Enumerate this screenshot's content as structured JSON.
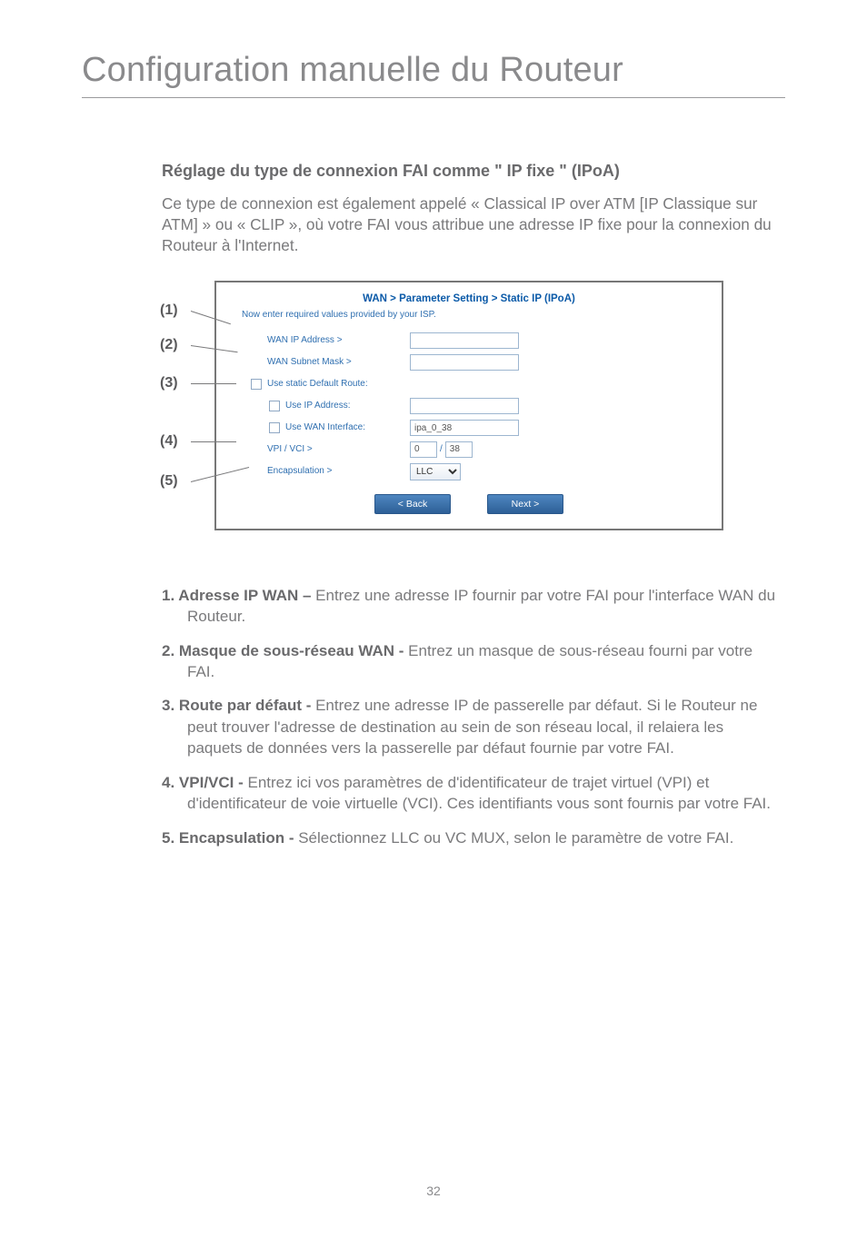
{
  "page": {
    "title": "Configuration manuelle du Routeur",
    "section_heading": "Réglage du type de connexion FAI comme \" IP fixe \" (IPoA)",
    "intro": "Ce type de connexion est également appelé « Classical IP over ATM [IP Classique sur ATM] » ou « CLIP », où votre FAI vous attribue une adresse IP fixe pour la connexion du Routeur à l'Internet.",
    "page_number": "32"
  },
  "callouts": {
    "c1": "(1)",
    "c2": "(2)",
    "c3": "(3)",
    "c4": "(4)",
    "c5": "(5)"
  },
  "shot": {
    "title": "WAN > Parameter Setting > Static IP (IPoA)",
    "subtitle": "Now enter required values provided by your ISP.",
    "labels": {
      "wan_ip": "WAN IP Address >",
      "wan_mask": "WAN Subnet Mask >",
      "static_route": "Use static Default Route:",
      "use_ip": "Use IP Address:",
      "use_wan_if": "Use WAN Interface:",
      "vpi_vci": "VPI / VCI >",
      "encap": "Encapsulation >"
    },
    "values": {
      "wan_ip": "",
      "wan_mask": "",
      "use_ip_value": "",
      "wan_interface": "ipa_0_38",
      "vpi": "0",
      "vci": "38",
      "encapsulation": "LLC"
    },
    "buttons": {
      "back": "< Back",
      "next": "Next >"
    }
  },
  "definitions": {
    "d1_label": "Adresse IP WAN – ",
    "d1_text": "Entrez une adresse IP fournir par votre FAI pour l'interface WAN du Routeur.",
    "d2_label": "Masque de sous-réseau WAN - ",
    "d2_text": "Entrez un masque de sous-réseau fourni par votre FAI.",
    "d3_label": "Route par défaut - ",
    "d3_text": "Entrez une adresse IP de passerelle par défaut. Si le Routeur ne peut trouver l'adresse de destination au sein de son réseau local, il relaiera les paquets de données vers la passerelle par défaut fournie par votre FAI.",
    "d4_label": " VPI/VCI - ",
    "d4_text": "Entrez ici vos paramètres de d'identificateur de trajet virtuel (VPI) et d'identificateur de voie virtuelle (VCI). Ces identifiants vous sont fournis par votre FAI.",
    "d5_label": "Encapsulation - ",
    "d5_text": "Sélectionnez LLC ou VC MUX, selon le paramètre de votre FAI."
  }
}
